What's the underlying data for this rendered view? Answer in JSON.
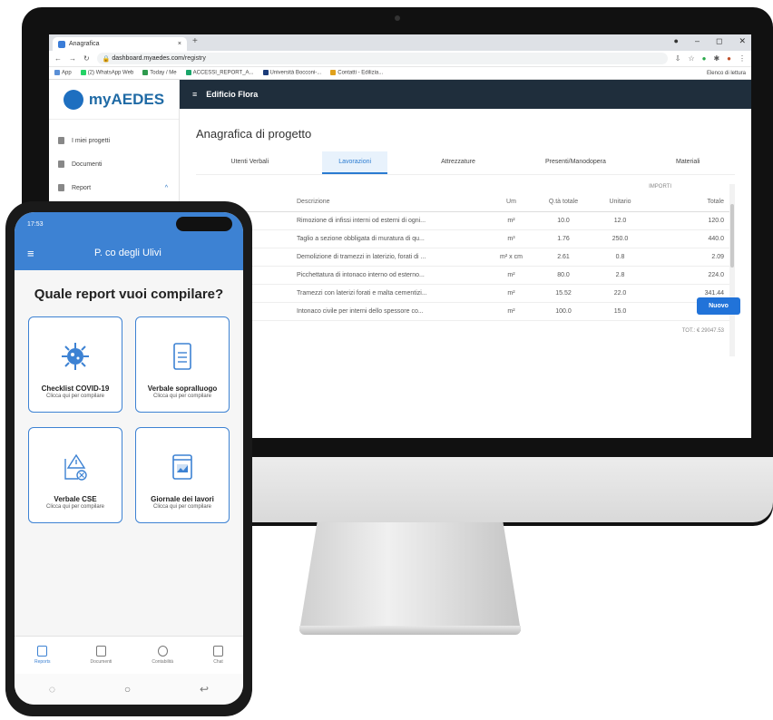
{
  "browser": {
    "tab_title": "Anagrafica",
    "tab_close": "×",
    "new_tab": "+",
    "url_host": "dashboard.myaedes.com",
    "url_path": "/registry",
    "bookmarks": [
      "App",
      "(2) WhatsApp Web",
      "Today / Me",
      "ACCESSI_REPORT_A...",
      "Università Bocconi-...",
      "Contatti - Edilizia..."
    ],
    "reading_list": "Elenco di lettura"
  },
  "app": {
    "logo": "myAEDES",
    "sidebar": [
      {
        "label": "I miei progetti"
      },
      {
        "label": "Documenti"
      },
      {
        "label": "Report"
      }
    ],
    "project": "Edificio Flora",
    "page_title": "Anagrafica di progetto",
    "tabs": [
      "Utenti Verbali",
      "Lavorazioni",
      "Attrezzature",
      "Presenti/Manodopera",
      "Materiali"
    ],
    "active_tab": 1,
    "table": {
      "group_header": "IMPORTI",
      "columns": [
        "Descrizione",
        "Um",
        "Q.tà totale",
        "Unitario",
        "Totale"
      ],
      "rows": [
        [
          "Rimozione di infissi interni od esterni di ogni...",
          "m²",
          "10.0",
          "12.0",
          "120.0"
        ],
        [
          "Taglio a sezione obbligata di muratura di qu...",
          "m³",
          "1.76",
          "250.0",
          "440.0"
        ],
        [
          "Demolizione di tramezzi in laterizio, forati di ...",
          "m² x cm",
          "2.61",
          "0.8",
          "2.09"
        ],
        [
          "Picchettatura di intonaco interno od esterno...",
          "m²",
          "80.0",
          "2.8",
          "224.0"
        ],
        [
          "Tramezzi con laterizi forati e malta cementizi...",
          "m²",
          "15.52",
          "22.0",
          "341.44"
        ],
        [
          "Intonaco civile per interni dello spessore co...",
          "m²",
          "100.0",
          "15.0",
          "1500.0"
        ]
      ],
      "total": "TOT.: € 29047.53"
    },
    "new_button": "Nuovo"
  },
  "phone": {
    "time": "17:53",
    "header_title": "P. co degli Ulivi",
    "question": "Quale report vuoi compilare?",
    "cards": [
      {
        "title": "Checklist COVID-19",
        "subtitle": "Clicca qui per compilare",
        "icon": "virus-icon"
      },
      {
        "title": "Verbale sopralluogo",
        "subtitle": "Clicca qui per compilare",
        "icon": "document-icon"
      },
      {
        "title": "Verbale CSE",
        "subtitle": "Clicca qui per compilare",
        "icon": "warning-document-icon"
      },
      {
        "title": "Giornale dei lavori",
        "subtitle": "Clicca qui per compilare",
        "icon": "chart-document-icon"
      }
    ],
    "bottom_nav": [
      "Reports",
      "Documenti",
      "Contabilità",
      "Chat"
    ],
    "accent": "#3d82d3"
  }
}
